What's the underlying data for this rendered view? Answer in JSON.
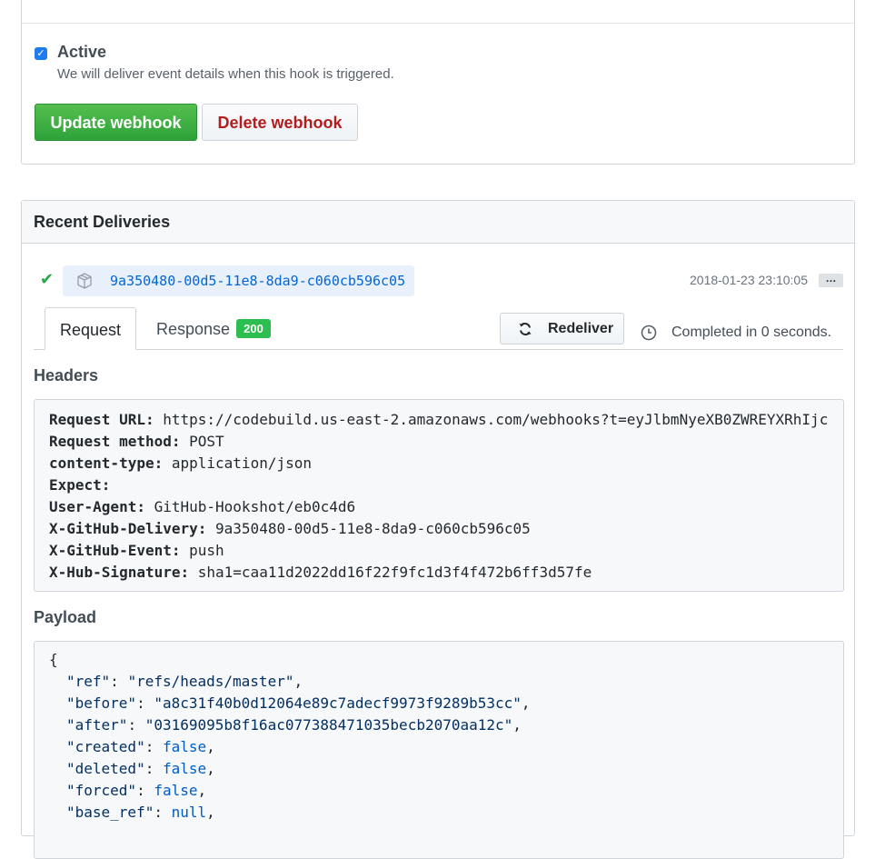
{
  "settings": {
    "active_label": "Active",
    "active_description": "We will deliver event details when this hook is triggered.",
    "update_button": "Update webhook",
    "delete_button": "Delete webhook"
  },
  "deliveries": {
    "title": "Recent Deliveries",
    "delivery": {
      "guid": "9a350480-00d5-11e8-8da9-c060cb596c05",
      "timestamp": "2018-01-23 23:10:05",
      "more_label": "…"
    },
    "tabs": {
      "request": "Request",
      "response": "Response",
      "response_status": "200"
    },
    "redeliver_button": "Redeliver",
    "completed_text": "Completed in 0 seconds.",
    "headers_title": "Headers",
    "headers": [
      {
        "key": "Request URL:",
        "value": "https://codebuild.us-east-2.amazonaws.com/webhooks?t=eyJlbmNyeXB0ZWREYXRhIjc"
      },
      {
        "key": "Request method:",
        "value": "POST"
      },
      {
        "key": "content-type:",
        "value": "application/json"
      },
      {
        "key": "Expect:",
        "value": ""
      },
      {
        "key": "User-Agent:",
        "value": "GitHub-Hookshot/eb0c4d6"
      },
      {
        "key": "X-GitHub-Delivery:",
        "value": "9a350480-00d5-11e8-8da9-c060cb596c05"
      },
      {
        "key": "X-GitHub-Event:",
        "value": "push"
      },
      {
        "key": "X-Hub-Signature:",
        "value": "sha1=caa11d2022dd16f22f9fc1d3f4f472b6ff3d57fe"
      }
    ],
    "payload_title": "Payload",
    "payload": {
      "open": "{",
      "lines": [
        {
          "key": "\"ref\"",
          "value": "\"refs/heads/master\""
        },
        {
          "key": "\"before\"",
          "value": "\"a8c31f40b0d12064e89c7adecf9973f9289b53cc\""
        },
        {
          "key": "\"after\"",
          "value": "\"03169095b8f16ac077388471035becb2070aa12c\""
        },
        {
          "key": "\"created\"",
          "value": "false"
        },
        {
          "key": "\"deleted\"",
          "value": "false"
        },
        {
          "key": "\"forced\"",
          "value": "false"
        },
        {
          "key": "\"base_ref\"",
          "value": "null"
        }
      ]
    }
  }
}
